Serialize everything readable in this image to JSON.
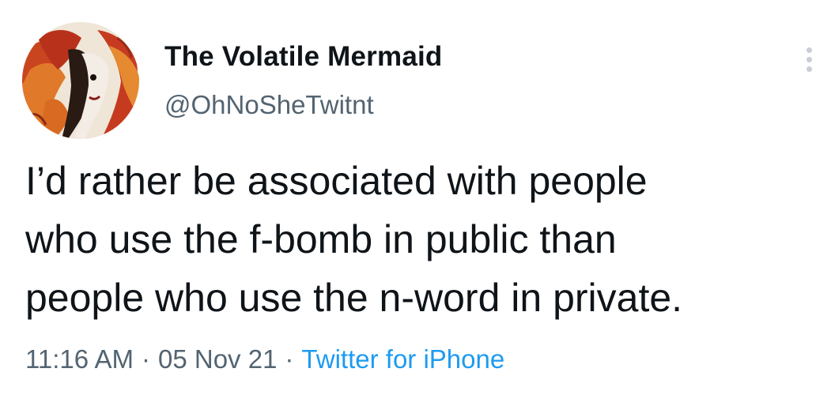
{
  "author": {
    "display_name": "The Volatile Mermaid",
    "handle": "@OhNoSheTwitnt",
    "avatar_icon": "profile-avatar"
  },
  "menu": {
    "icon": "more-options-icon"
  },
  "tweet": {
    "lines": [
      "I’d rather be associated with people",
      "who use the f-bomb in public than",
      "people who use the n-word in private."
    ],
    "time": "11:16 AM",
    "separator": "·",
    "date": "05 Nov 21",
    "source": "Twitter for iPhone"
  },
  "colors": {
    "text": "#0f1419",
    "secondary": "#536471",
    "link": "#1d9bf0"
  }
}
